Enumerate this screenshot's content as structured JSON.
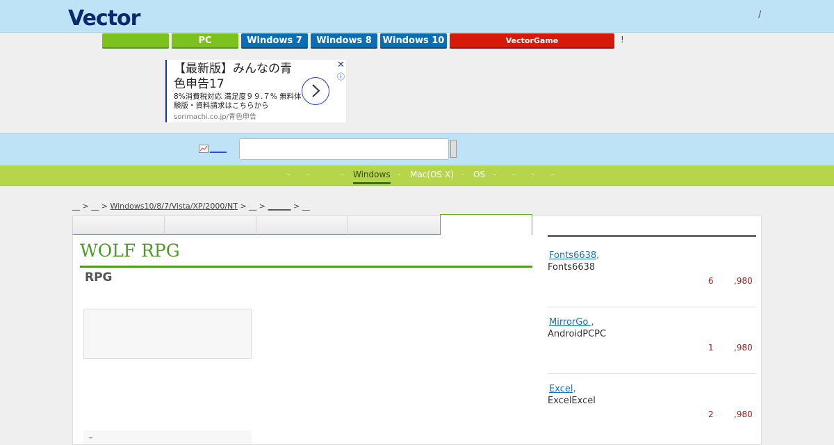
{
  "header": {
    "logo_text": "Vector",
    "right_text": "/"
  },
  "category_nav": {
    "items": [
      {
        "label": "",
        "color": "#7cc21e"
      },
      {
        "label": "PC",
        "color": "#7cc21e"
      },
      {
        "label": "Windows 7",
        "color": "#0b6eb3"
      },
      {
        "label": "Windows 8",
        "color": "#0b6eb3"
      },
      {
        "label": "Windows 10",
        "color": "#0b6eb3"
      },
      {
        "label": "VectorGame",
        "color": "#d7190a"
      }
    ],
    "trailing": "!"
  },
  "ad": {
    "title": "【最新版】みんなの青色申告17",
    "description": "8%消費税対応 満足度９９.７% 無料体験版・資料請求はこちらから",
    "url": "sorimachi.co.jp/青色申告",
    "close": "✕",
    "info": "ⓘ"
  },
  "search": {
    "link_text": "____",
    "placeholder": "",
    "icon": "chart-icon"
  },
  "platform_nav": {
    "items": [
      "-",
      "-",
      "-",
      "Windows",
      "-",
      "Mac(OS X)",
      "-",
      "OS",
      "-",
      "-",
      "-",
      "-"
    ],
    "active": "Windows"
  },
  "breadcrumb": {
    "parts": [
      "__",
      ">",
      "__",
      ">",
      "Windows10/8/7/Vista/XP/2000/NT",
      ">",
      "__",
      ">",
      "______",
      ">",
      "__"
    ]
  },
  "main": {
    "tabs": [
      "",
      "",
      "",
      "",
      ""
    ],
    "active_tab_index": 4,
    "title": "WOLF RPG",
    "subtitle": "RPG",
    "bottom_box_text": "_"
  },
  "sidebar": {
    "items": [
      {
        "link": "Fonts6638",
        "comma": ",",
        "desc": "Fonts6638",
        "num_a": "6",
        "num_b": ",980"
      },
      {
        "link": "MirrorGo ",
        "comma": ",",
        "desc": "AndroidPCPC",
        "num_a": "1",
        "num_b": ",980"
      },
      {
        "link": "Excel",
        "comma": ",",
        "desc": "ExcelExcel",
        "num_a": "2",
        "num_b": ",980"
      }
    ]
  }
}
